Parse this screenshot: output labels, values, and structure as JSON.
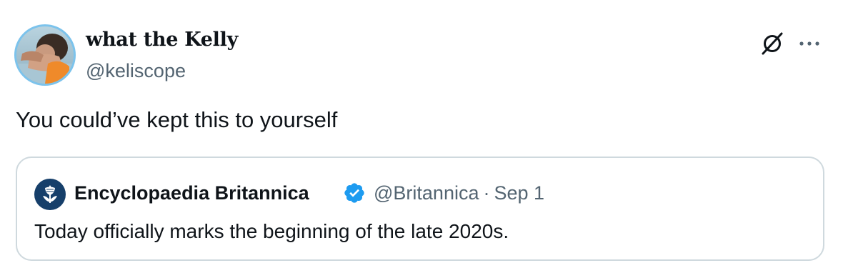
{
  "author": {
    "display_name": "what the Kelly",
    "handle": "@keliscope"
  },
  "actions": {
    "grok_icon": "grok-icon",
    "more_icon": "more-icon"
  },
  "tweet": {
    "text": "You could’ve kept this to yourself"
  },
  "quoted_tweet": {
    "author_name": "Encyclopaedia Britannica",
    "verified": true,
    "handle": "@Britannica",
    "separator": "·",
    "date": "Sep 1",
    "text": "Today officially marks the beginning of the late 2020s."
  },
  "colors": {
    "text_primary": "#0f1419",
    "text_secondary": "#536471",
    "border": "#cfd9de",
    "verified_badge": "#1d9bf0",
    "britannica_brand": "#163f6a",
    "avatar_ring": "#7cc3ec"
  }
}
